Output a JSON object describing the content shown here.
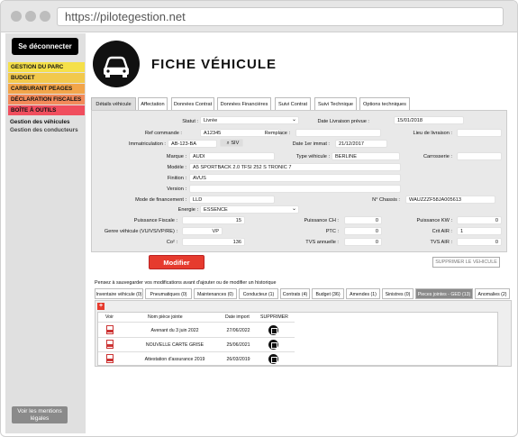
{
  "browser": {
    "url": "https://pilotegestion.net"
  },
  "sidebar": {
    "logout_label": "Se déconnecter",
    "menu": [
      {
        "label": "GESTION DU PARC",
        "color": "#f5e04a"
      },
      {
        "label": "BUDGET",
        "color": "#f2c94c"
      },
      {
        "label": "CARBURANT PEAGES",
        "color": "#f2a54a"
      },
      {
        "label": "DÉCLARATION FISCALES",
        "color": "#f28a5a"
      },
      {
        "label": "BOÎTE À OUTILS",
        "color": "#f04e5e"
      }
    ],
    "sub_items": [
      "Gestion des véhicules",
      "Gestion des conducteurs"
    ],
    "legal_label": "Voir les mentions légales"
  },
  "page": {
    "title": "FICHE VÉHICULE",
    "icon": "car-icon"
  },
  "tabs": [
    "Détails véhicule",
    "Affectation",
    "Données Contrat",
    "Données Financières",
    "Suivi Contrat",
    "Suivi Technique",
    "Options techniques"
  ],
  "form": {
    "statut_label": "Statut :",
    "statut_value": "Livrée",
    "date_livraison_label": "Date Livraison prévue :",
    "date_livraison_value": "15/01/2018",
    "ref_label": "Ref commande :",
    "ref_value": "A12345",
    "remplace_label": "Remplace :",
    "lieu_label": "Lieu de livraison :",
    "immat_label": "Immatriculation :",
    "immat_value": "AB-123-BA",
    "siv_label": "SIV",
    "date_immat_label": "Date 1er immat :",
    "date_immat_value": "21/12/2017",
    "marque_label": "Marque :",
    "marque_value": "AUDI",
    "type_label": "Type véhicule :",
    "type_value": "BERLINE",
    "carrosserie_label": "Carrosserie :",
    "modele_label": "Modèle :",
    "modele_value": "A5 SPORTBACK 2.0 TFSI 252 S TRONIC 7",
    "finition_label": "Finition :",
    "finition_value": "AVUS",
    "version_label": "Version :",
    "mode_label": "Mode de financement :",
    "mode_value": "LLD",
    "chassis_label": "N° Chassis :",
    "chassis_value": "WAUZZZF58JA005613",
    "energie_label": "Energie :",
    "energie_value": "ESSENCE",
    "pf_label": "Puissance Fiscale :",
    "pf_value": "15",
    "pch_label": "Puissance CH :",
    "pch_value": "0",
    "pkw_label": "Puissance KW :",
    "pkw_value": "0",
    "genre_label": "Genre véhicule (VU/VS/VP/RE) :",
    "genre_value": "VP",
    "ptc_label": "PTC :",
    "ptc_value": "0",
    "critair_label": "Crit AIR :",
    "critair_value": "1",
    "co2_label": "Co² :",
    "co2_value": "136",
    "tvs_label": "TVS annuelle :",
    "tvs_value": "0",
    "tvsair_label": "TVS AIR :",
    "tvsair_value": "0"
  },
  "buttons": {
    "modifier": "Modifier",
    "supprimer": "SUPPRIMER LE VEHICULE"
  },
  "note": "Pensez à sauvegarder vos modifications avant d'ajouter ou de modifier un historique",
  "bottom_tabs": [
    "Inventaire véhicule (0)",
    "Pneumatiques (0)",
    "Maintenances (0)",
    "Conducteur (1)",
    "Contrats (4)",
    "Budget (36)",
    "Amendes (1)",
    "Sinistres (0)",
    "Pieces jointes - GED (13)",
    "Anomalies (2)"
  ],
  "attachments": {
    "plus": "+",
    "headers": [
      "Voir",
      "Nom pièce jointe",
      "Date import",
      "SUPPRIMER"
    ],
    "rows": [
      {
        "name": "Avenant du 3 juin 2022",
        "date": "27/06/2022"
      },
      {
        "name": "NOUVELLE CARTE GRISE",
        "date": "25/06/2021"
      },
      {
        "name": "Attestation d'assurance 2019",
        "date": "26/03/2019"
      }
    ]
  }
}
